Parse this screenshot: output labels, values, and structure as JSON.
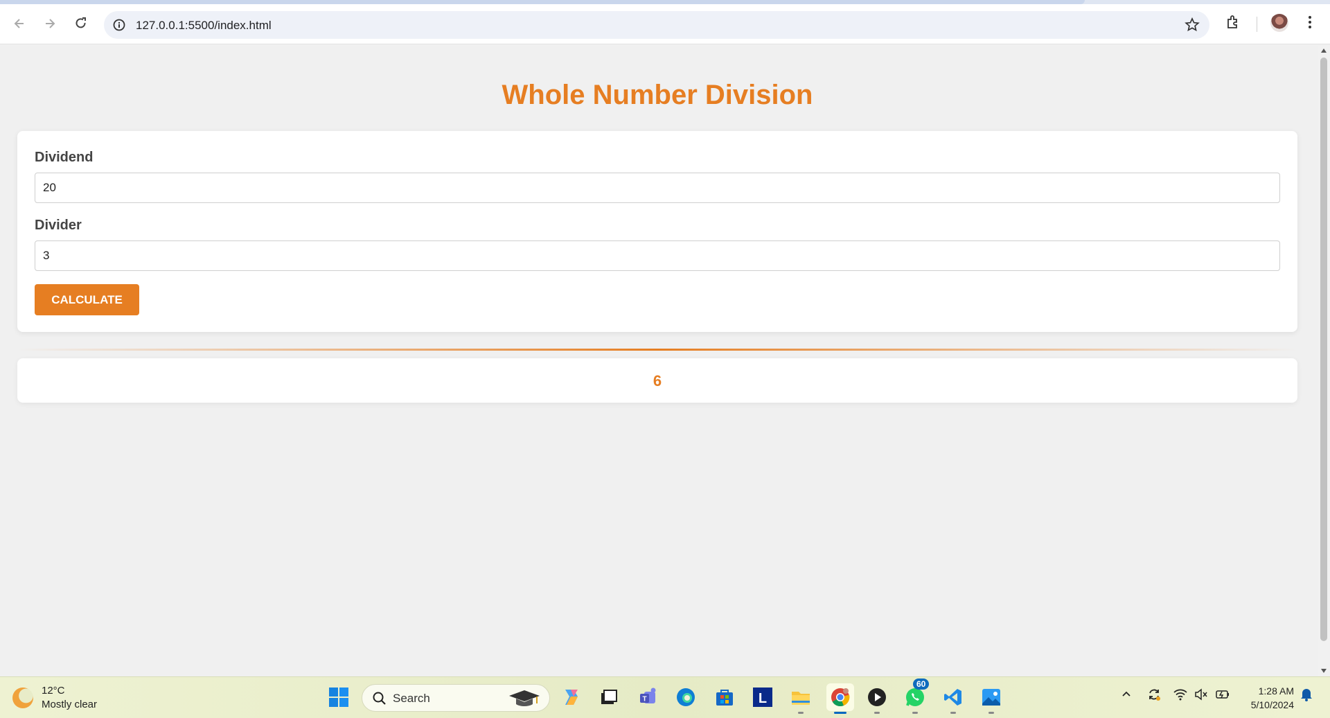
{
  "browser": {
    "url": "127.0.0.1:5500/index.html"
  },
  "page": {
    "title": "Whole Number Division",
    "dividend_label": "Dividend",
    "dividend_value": "20",
    "divider_label": "Divider",
    "divider_value": "3",
    "calculate_label": "CALCULATE",
    "result": "6",
    "accent_color": "#e67e22"
  },
  "taskbar": {
    "weather_temp": "12°C",
    "weather_desc": "Mostly clear",
    "search_label": "Search",
    "whatsapp_badge": "60",
    "time": "1:28 AM",
    "date": "5/10/2024"
  }
}
